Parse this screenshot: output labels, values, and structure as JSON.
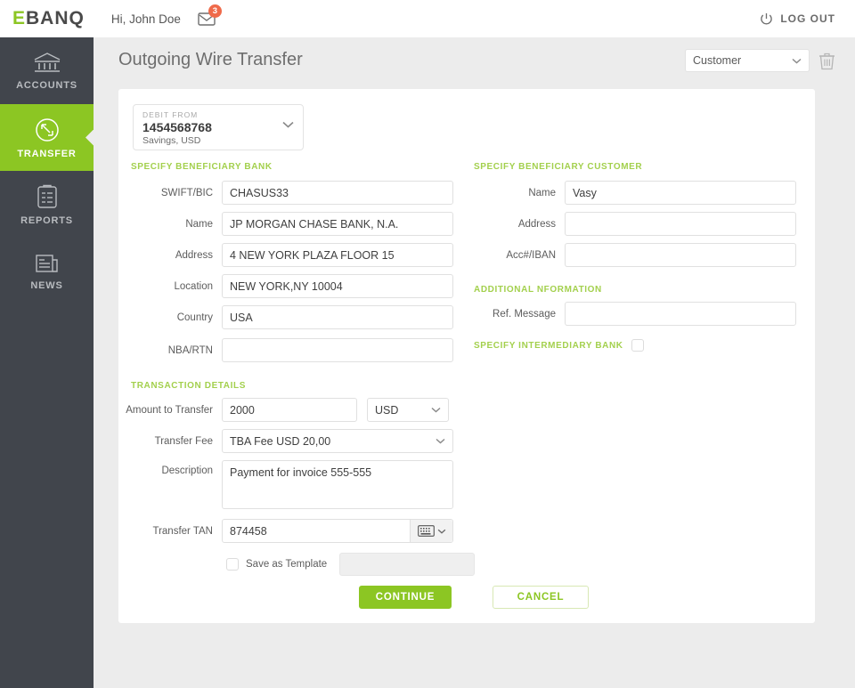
{
  "header": {
    "logo_e": "E",
    "logo_rest": "BANQ",
    "greeting": "Hi, John Doe",
    "messages_icon": "envelope-icon",
    "messages_count": "3",
    "logout_label": "LOG OUT",
    "power_icon": "power-icon"
  },
  "sidebar": {
    "items": [
      {
        "label": "ACCOUNTS",
        "icon": "bank-icon",
        "active": false
      },
      {
        "label": "TRANSFER",
        "icon": "transfer-arrows-icon",
        "active": true
      },
      {
        "label": "REPORTS",
        "icon": "clipboard-icon",
        "active": false
      },
      {
        "label": "NEWS",
        "icon": "newspaper-icon",
        "active": false
      }
    ]
  },
  "page": {
    "title": "Outgoing Wire Transfer",
    "customer_select": "Customer",
    "delete_icon": "trash-icon"
  },
  "debit_from": {
    "label": "DEBIT FROM",
    "account": "1454568768",
    "subtitle": "Savings, USD"
  },
  "sections": {
    "beneficiary_bank": "SPECIFY BENEFICIARY BANK",
    "beneficiary_customer": "SPECIFY BENEFICIARY CUSTOMER",
    "additional_information": "ADDITIONAL NFORMATION",
    "intermediary_bank": "SPECIFY INTERMEDIARY BANK",
    "transaction_details": "TRANSACTION DETAILS"
  },
  "bank_fields": [
    {
      "label": "SWIFT/BIC",
      "value": "CHASUS33"
    },
    {
      "label": "Name",
      "value": "JP MORGAN CHASE BANK, N.A."
    },
    {
      "label": "Address",
      "value": "4 NEW YORK PLAZA FLOOR 15"
    },
    {
      "label": "Location",
      "value": "NEW YORK,NY 10004"
    },
    {
      "label": "Country",
      "value": "USA"
    },
    {
      "label": "NBA/RTN",
      "value": ""
    }
  ],
  "customer_fields": [
    {
      "label": "Name",
      "value": "Vasy"
    },
    {
      "label": "Address",
      "value": ""
    },
    {
      "label": "Acc#/IBAN",
      "value": ""
    }
  ],
  "additional": {
    "ref_message_label": "Ref. Message",
    "ref_message_value": ""
  },
  "transaction": {
    "amount_label": "Amount to Transfer",
    "amount_value": "2000",
    "currency_value": "USD",
    "fee_label": "Transfer Fee",
    "fee_value": "TBA Fee USD 20,00",
    "description_label": "Description",
    "description_value": "Payment for invoice 555-555",
    "tan_label": "Transfer TAN",
    "tan_value": "874458",
    "keyboard_icon": "keyboard-icon",
    "save_template_label": "Save as Template",
    "save_template_value": ""
  },
  "actions": {
    "continue_label": "CONTINUE",
    "cancel_label": "CANCEL"
  },
  "colors": {
    "accent_green": "#8cc623",
    "sidebar_dark": "#41454c",
    "badge_orange": "#ef6a4a",
    "section_green": "#a3d04d"
  }
}
